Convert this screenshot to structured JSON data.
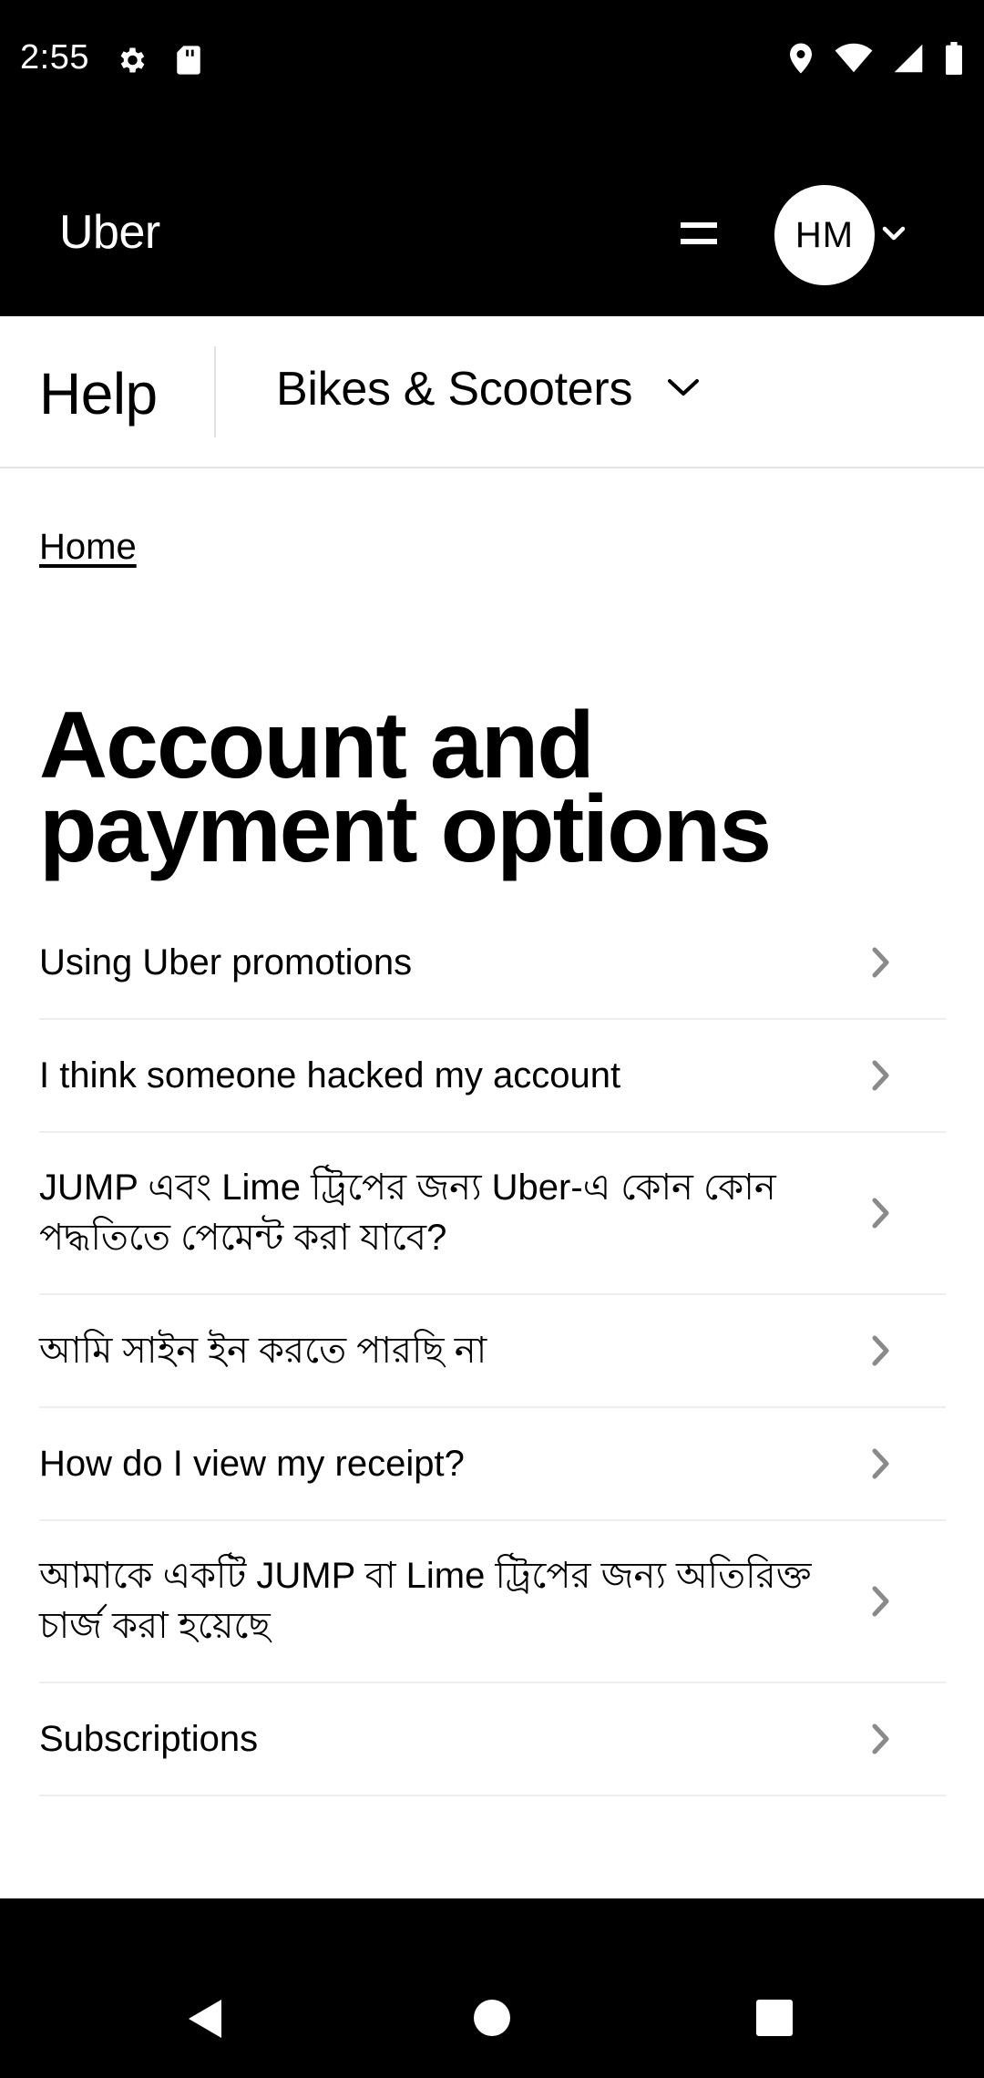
{
  "status_bar": {
    "time": "2:55",
    "left_icons": [
      "gear-icon",
      "sd-card-icon"
    ],
    "right_icons": [
      "location-icon",
      "wifi-icon",
      "signal-icon",
      "battery-icon"
    ]
  },
  "header": {
    "logo": "Uber",
    "avatar_initials": "HM",
    "menu_icon": "menu-icon",
    "dropdown_icon": "chevron-down-icon"
  },
  "help_nav": {
    "title": "Help",
    "category": "Bikes & Scooters"
  },
  "breadcrumb": {
    "home": "Home"
  },
  "page_title": "Account and payment options",
  "topics": [
    "Using Uber promotions",
    "I think someone hacked my account",
    "JUMP এবং Lime ট্রিপের জন্য Uber-এ কোন কোন পদ্ধতিতে পেমেন্ট করা যাবে?",
    "আমি সাইন ইন করতে পারছি না",
    "How do I view my receipt?",
    "আমাকে একটি JUMP বা Lime ট্রিপের জন্য অতিরিক্ত চার্জ করা হয়েছে",
    "Subscriptions"
  ],
  "colors": {
    "header_bg": "#000000",
    "divider": "#e2e2e2",
    "chevron": "#8a8a8a"
  }
}
